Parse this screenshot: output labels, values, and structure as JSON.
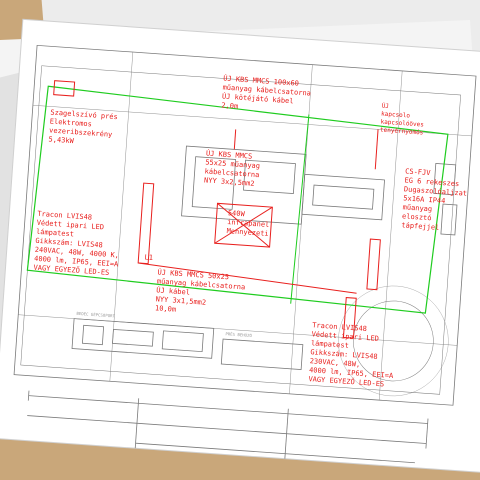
{
  "drawing": {
    "annotations": [
      {
        "id": "cable-top",
        "lines": [
          "ÚJ KBS MMCS 100x60",
          "műanyag kábelcsatorna",
          "ÚJ kötéjátó kábel",
          "2,0m"
        ]
      },
      {
        "id": "kapcsolo",
        "lines": [
          "ÚJ",
          "kapcsolo",
          "kapcsolóöves",
          "tenyérnyomós"
        ]
      },
      {
        "id": "szagelszivo",
        "lines": [
          "Szagelszívó prés",
          "Elektromos",
          "vezeribszekrény",
          "5,43kW"
        ]
      },
      {
        "id": "cable-mid",
        "lines": [
          "ÚJ KBS MMCS",
          "55x25 műanyag",
          "kábelcsatorna",
          "NYY 3x2,5mm2"
        ]
      },
      {
        "id": "cs-box",
        "lines": [
          "CS-FJV",
          "EG 6 rekeszes",
          "Dugaszolóaljzat",
          "5x16A IP44",
          "műanyag",
          "elosztó",
          "tápfejjel"
        ]
      },
      {
        "id": "infra-panel",
        "lines": [
          "540W",
          "infrapanel",
          "Mennyezeti"
        ]
      },
      {
        "id": "tracon-left",
        "lines": [
          "Tracon LVIS48",
          "Védett ipari LED",
          "lámpatest",
          "Gikkszám: LVIS48",
          "240VAC, 48W, 4000 K,",
          "4000 lm, IP65, EEI=A",
          "VAGY EGYEZŐ LED-ES"
        ]
      },
      {
        "id": "cable-bottom",
        "lines": [
          "ÚJ KBS MMCS 50x25",
          "műanyag kábelcsatorna",
          "ÚJ kábel",
          "NYY 3x1,5mm2",
          "10,0m"
        ]
      },
      {
        "id": "tracon-right",
        "lines": [
          "Tracon LVIS48",
          "Védett ipari LED",
          "lámpatest",
          "Gikkszám: LVIS48",
          "230VAC, 48W,",
          "4000 lm, IP65, EEI=A",
          "VAGY EGYEZŐ LED-ES"
        ]
      }
    ],
    "room_label": "L1",
    "equipment_labels": [
      "BEDEC GÉPCSOPORT",
      "PRÉS BEHÚZÓ"
    ]
  },
  "colors": {
    "annotation": "#e8201e",
    "outline_green": "#1fcc1f",
    "linework": "#6a6a6a",
    "paper": "#ffffff",
    "table": "#c9a77a"
  }
}
